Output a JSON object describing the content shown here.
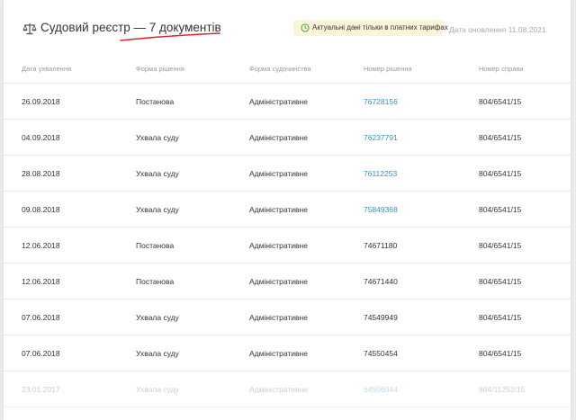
{
  "header": {
    "icon": "scales-icon",
    "title": "Судовий реєстр — 7 документів",
    "badge_icon": "clock-icon",
    "badge_text": "Актуальні дані тільки в платних тарифах",
    "updated": "Дата оновлення 11.08.2021"
  },
  "colors": {
    "link": "#3a8fc6",
    "underline": "#d7262b",
    "badge_bg": "#fbf4d9",
    "badge_icon": "#47a447"
  },
  "table": {
    "columns": [
      "Дата ухвалення",
      "Форма рішення",
      "Форма судочинства",
      "Номер рішення",
      "Номер справи"
    ],
    "rows": [
      {
        "date": "26.09.2018",
        "form": "Постанова",
        "proc": "Адміністративне",
        "decision": "76728156",
        "case": "804/6541/15"
      },
      {
        "date": "04.09.2018",
        "form": "Ухвала суду",
        "proc": "Адміністративне",
        "decision": "76237791",
        "case": "804/6541/15"
      },
      {
        "date": "28.08.2018",
        "form": "Ухвала суду",
        "proc": "Адміністративне",
        "decision": "76112253",
        "case": "804/6541/15"
      },
      {
        "date": "09.08.2018",
        "form": "Ухвала суду",
        "proc": "Адміністративне",
        "decision": "75849368",
        "case": "804/6541/15"
      },
      {
        "date": "12.06.2018",
        "form": "Постанова",
        "proc": "Адміністративне",
        "decision": "74671180",
        "case": "804/6541/15"
      },
      {
        "date": "12.06.2018",
        "form": "Постанова",
        "proc": "Адміністративне",
        "decision": "74671440",
        "case": "804/6541/15"
      },
      {
        "date": "07.06.2018",
        "form": "Ухвала суду",
        "proc": "Адміністративне",
        "decision": "74549949",
        "case": "804/6541/15"
      },
      {
        "date": "07.06.2018",
        "form": "Ухвала суду",
        "proc": "Адміністративне",
        "decision": "74550454",
        "case": "804/6541/15"
      },
      {
        "date": "23.01.2017",
        "form": "Ухвала суду",
        "proc": "Адміністративне",
        "decision": "64506044",
        "case": "804/11252/15"
      }
    ]
  }
}
